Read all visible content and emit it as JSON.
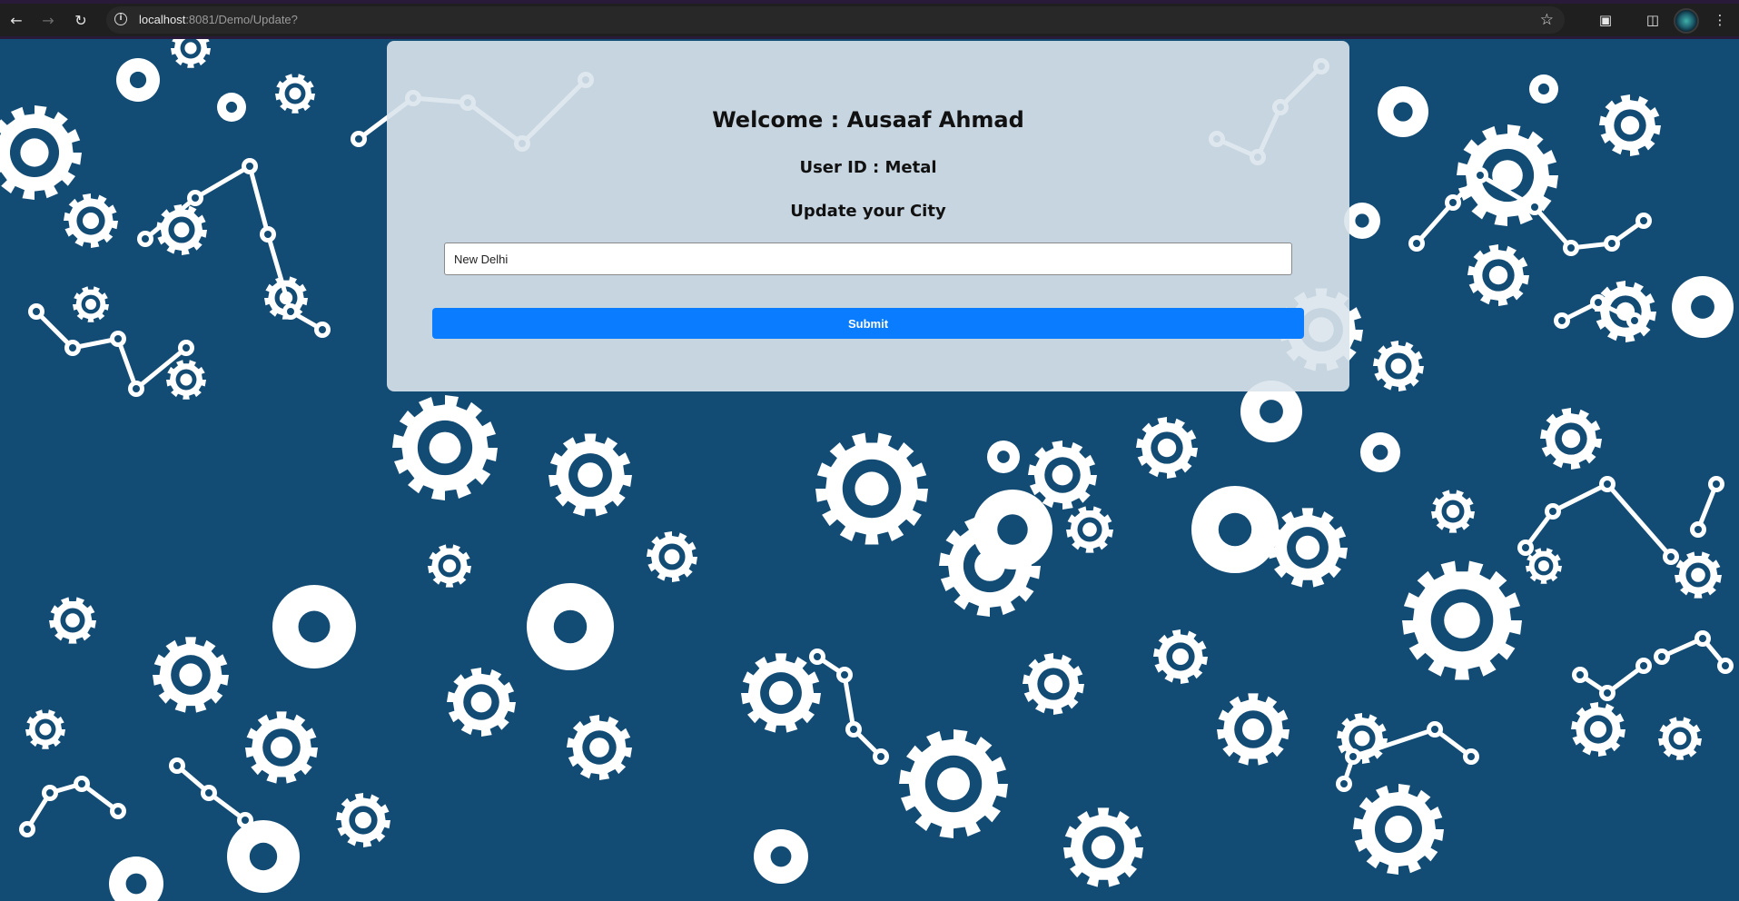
{
  "browser": {
    "url_host": "localhost",
    "url_rest": ":8081/Demo/Update?",
    "back_icon": "arrow-left-icon",
    "forward_icon": "arrow-right-icon",
    "reload_icon": "reload-icon",
    "bookmark_icon": "star-icon",
    "extensions_icon": "puzzle-icon",
    "sidepanel_icon": "side-panel-icon",
    "menu_icon": "kebab-menu-icon"
  },
  "form": {
    "welcome": "Welcome : Ausaaf Ahmad",
    "user_id": "User ID : Metal",
    "update_heading": "Update your City",
    "city_value": "New Delhi",
    "submit_label": "Submit"
  },
  "colors": {
    "background": "#124b74",
    "card": "#dae4ec",
    "submit": "#0a7cff",
    "pattern": "#ffffff"
  }
}
